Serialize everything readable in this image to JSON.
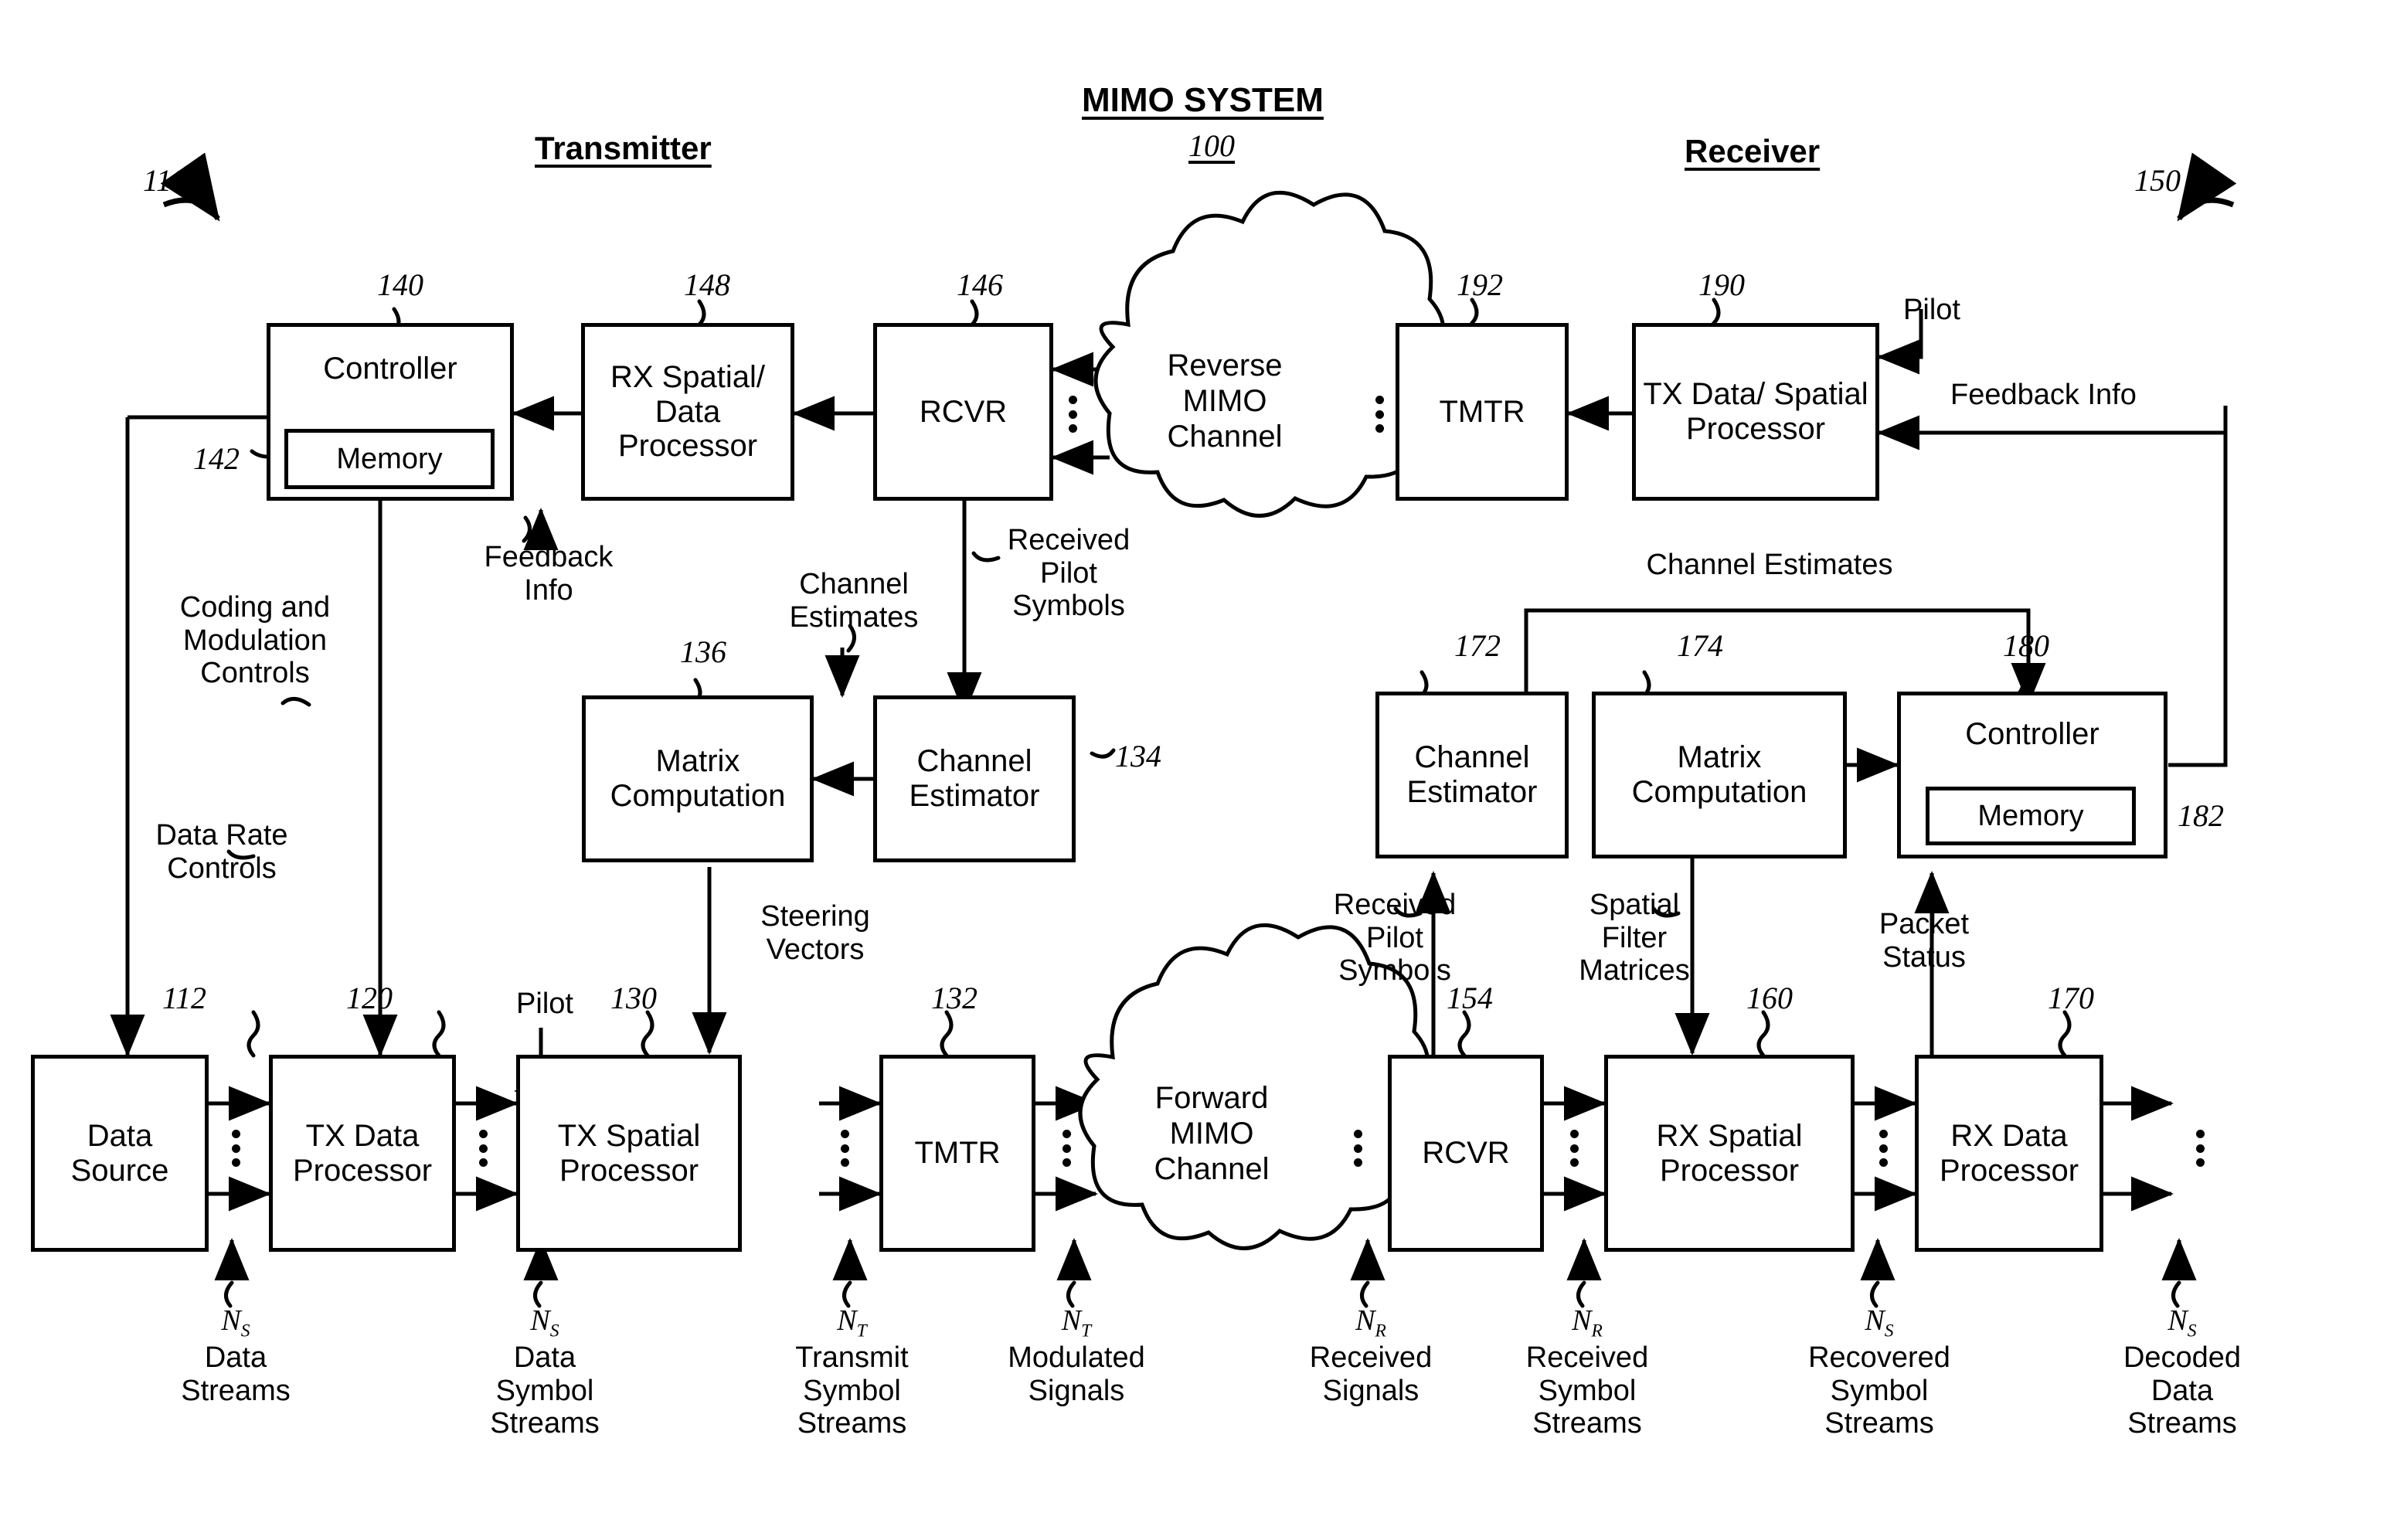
{
  "title": {
    "text": "MIMO SYSTEM",
    "number": "100"
  },
  "headers": {
    "transmitter": "Transmitter",
    "receiver": "Receiver"
  },
  "side_refs": {
    "transmitter": "110",
    "receiver": "150"
  },
  "blocks": {
    "controller_tx": {
      "label": "Controller",
      "ref": "140"
    },
    "memory_tx": {
      "label": "Memory",
      "ref": "142"
    },
    "rx_spatial_data_processor": {
      "label": "RX Spatial/\nData\nProcessor",
      "ref": "148"
    },
    "rcvr_tx": {
      "label": "RCVR",
      "ref": "146"
    },
    "tmtr_rx": {
      "label": "TMTR",
      "ref": "192"
    },
    "tx_data_spatial_processor": {
      "label": "TX Data/\nSpatial\nProcessor",
      "ref": "190"
    },
    "matrix_computation_tx": {
      "label": "Matrix\nComputation",
      "ref": "136"
    },
    "channel_estimator_tx": {
      "label": "Channel\nEstimator",
      "ref": "134"
    },
    "channel_estimator_rx": {
      "label": "Channel\nEstimator",
      "ref": "172"
    },
    "matrix_computation_rx": {
      "label": "Matrix\nComputation",
      "ref": "174"
    },
    "controller_rx": {
      "label": "Controller",
      "ref": "180"
    },
    "memory_rx": {
      "label": "Memory",
      "ref": "182"
    },
    "data_source": {
      "label": "Data\nSource",
      "ref": "112"
    },
    "tx_data_processor": {
      "label": "TX Data\nProcessor",
      "ref": "120"
    },
    "tx_spatial_processor": {
      "label": "TX Spatial\nProcessor",
      "ref": "130"
    },
    "tmtr_tx": {
      "label": "TMTR",
      "ref": "132"
    },
    "rcvr_rx": {
      "label": "RCVR",
      "ref": "154"
    },
    "rx_spatial_processor": {
      "label": "RX Spatial\nProcessor",
      "ref": "160"
    },
    "rx_data_processor": {
      "label": "RX Data\nProcessor",
      "ref": "170"
    }
  },
  "clouds": {
    "reverse": "Reverse\nMIMO\nChannel",
    "forward": "Forward\nMIMO\nChannel"
  },
  "signal_labels": {
    "pilot_top": "Pilot",
    "feedback_info_right": "Feedback Info",
    "feedback_info_left": "Feedback\nInfo",
    "coding_modulation_controls": "Coding and\nModulation\nControls",
    "data_rate_controls": "Data Rate\nControls",
    "channel_estimates_tx": "Channel\nEstimates",
    "received_pilot_symbols_tx": "Received\nPilot\nSymbols",
    "steering_vectors": "Steering\nVectors",
    "pilot_bottom": "Pilot",
    "channel_estimates_rx": "Channel Estimates",
    "received_pilot_symbols_rx": "Received\nPilot\nSymbols",
    "spatial_filter_matrices": "Spatial\nFilter\nMatrices",
    "packet_status": "Packet\nStatus"
  },
  "stream_labels": [
    {
      "sym": "N",
      "sub": "S",
      "text": "Data\nStreams"
    },
    {
      "sym": "N",
      "sub": "S",
      "text": "Data\nSymbol\nStreams"
    },
    {
      "sym": "N",
      "sub": "T",
      "text": "Transmit\nSymbol\nStreams"
    },
    {
      "sym": "N",
      "sub": "T",
      "text": "Modulated\nSignals"
    },
    {
      "sym": "N",
      "sub": "R",
      "text": "Received\nSignals"
    },
    {
      "sym": "N",
      "sub": "R",
      "text": "Received\nSymbol\nStreams"
    },
    {
      "sym": "N",
      "sub": "S",
      "text": "Recovered\nSymbol\nStreams"
    },
    {
      "sym": "N",
      "sub": "S",
      "text": "Decoded\nData\nStreams"
    }
  ],
  "colors": {
    "ink": "#000000",
    "paper": "#ffffff"
  }
}
